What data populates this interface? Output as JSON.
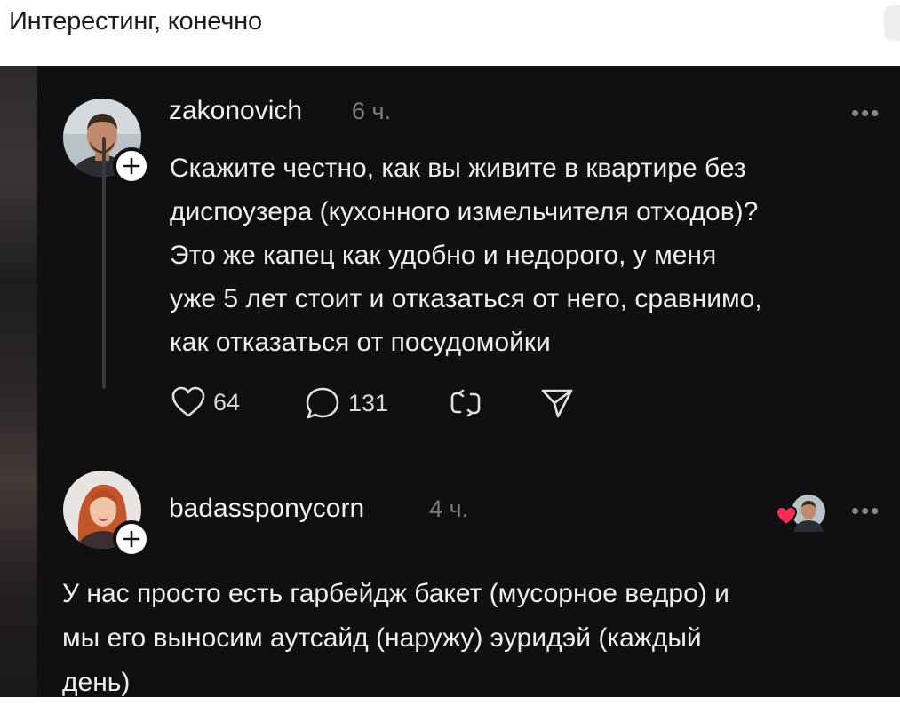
{
  "header": {
    "title": "Интерестинг, конечно"
  },
  "post": {
    "username": "zakonovich",
    "time": "6 ч.",
    "more": "•••",
    "text_lines": [
      "Скажите честно, как вы живите в квартире без",
      "диспоузера (кухонного измельчителя отходов)?",
      "Это же капец как удобно и недорого, у меня",
      "уже 5 лет стоит и отказаться от него, сравнимо,",
      "как отказаться от посудомойки"
    ],
    "likes": "64",
    "replies": "131"
  },
  "reply": {
    "username": "badassponycorn",
    "time": "4 ч.",
    "more": "•••",
    "text_lines": [
      "У нас просто есть гарбейдж бакет (мусорное ведро) и",
      "мы его выносим аутсайд (наружу) эуридэй (каждый",
      "день)"
    ]
  },
  "colors": {
    "background": "#100f11",
    "text": "#eeeeee",
    "muted": "#7b7b7e",
    "heart": "#ff2d55"
  },
  "icons": [
    "heart-icon",
    "comment-icon",
    "repost-icon",
    "share-icon",
    "plus-icon",
    "more-icon"
  ]
}
